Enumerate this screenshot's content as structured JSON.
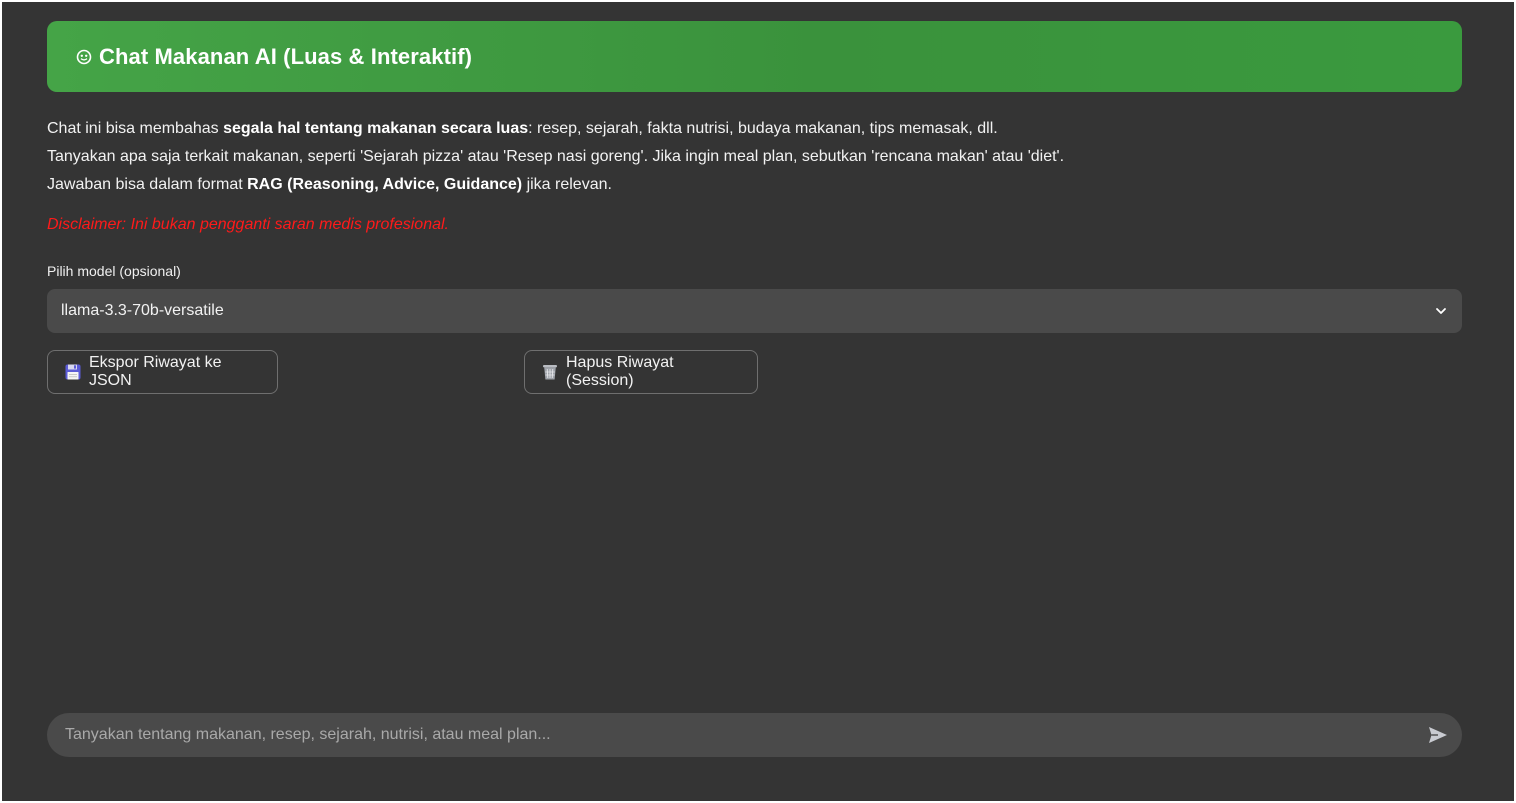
{
  "header": {
    "title": "Chat Makanan AI (Luas & Interaktif)",
    "icon": "face-icon",
    "gradient_colors": [
      "#45a447",
      "#3a923c"
    ]
  },
  "description": {
    "line1_prefix": "Chat ini bisa membahas ",
    "line1_bold": "segala hal tentang makanan secara luas",
    "line1_suffix": ": resep, sejarah, fakta nutrisi, budaya makanan, tips memasak, dll.",
    "line2": "Tanyakan apa saja terkait makanan, seperti 'Sejarah pizza' atau 'Resep nasi goreng'. Jika ingin meal plan, sebutkan 'rencana makan' atau 'diet'.",
    "line3_prefix": "Jawaban bisa dalam format ",
    "line3_bold": "RAG (Reasoning, Advice, Guidance)",
    "line3_suffix": " jika relevan."
  },
  "disclaimer": "Disclaimer: Ini bukan pengganti saran medis profesional.",
  "model_select": {
    "label": "Pilih model (opsional)",
    "value": "llama-3.3-70b-versatile"
  },
  "buttons": {
    "export_label": "Ekspor Riwayat ke JSON",
    "export_icon": "floppy-disk-icon",
    "clear_label": "Hapus Riwayat (Session)",
    "clear_icon": "trash-bin-icon"
  },
  "chat_input": {
    "placeholder": "Tanyakan tentang makanan, resep, sejarah, nutrisi, atau meal plan...",
    "value": ""
  },
  "colors": {
    "background": "#343434",
    "accent_green": "#3f9b42",
    "disclaimer_red": "#ff1a1a",
    "input_bg": "#4a4a4a"
  }
}
